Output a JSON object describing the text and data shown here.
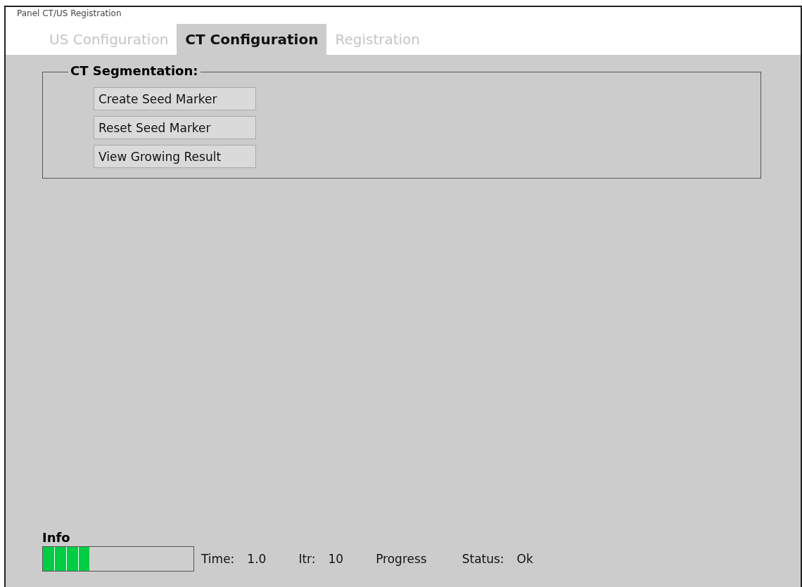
{
  "window": {
    "title": "Panel CT/US Registration"
  },
  "tabs": [
    {
      "label": "US Configuration",
      "selected": false
    },
    {
      "label": "CT Configuration",
      "selected": true
    },
    {
      "label": "Registration",
      "selected": false
    }
  ],
  "group": {
    "title": "CT Segmentation:",
    "buttons": [
      "Create Seed Marker",
      "Reset Seed Marker",
      "View Growing Result"
    ]
  },
  "info": {
    "title": "Info",
    "progress": {
      "level": 0.31
    },
    "fields": [
      {
        "label": "Time:",
        "value": "1.0"
      },
      {
        "label": "Itr:",
        "value": "10"
      },
      {
        "label": "Progress"
      },
      {
        "label": "Status:",
        "value": "Ok"
      }
    ]
  }
}
